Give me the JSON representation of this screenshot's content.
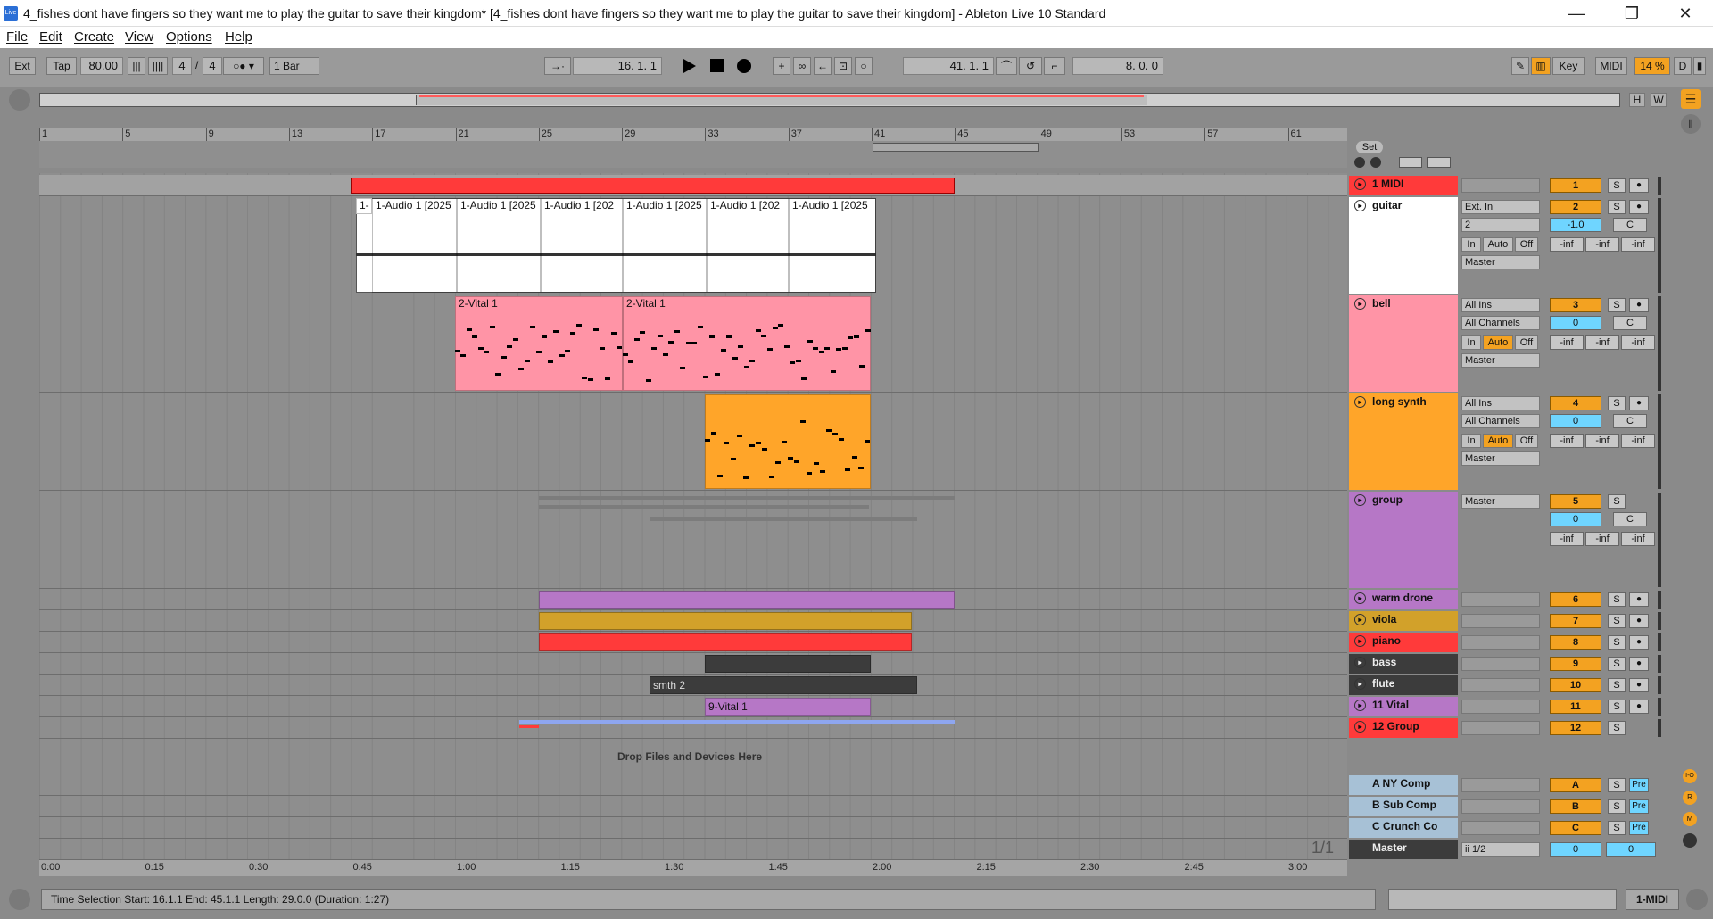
{
  "window": {
    "title": "4_fishes dont have fingers so they want me to play the guitar to save their kingdom*  [4_fishes dont have fingers so they want me to play the guitar to save their kingdom] - Ableton Live 10 Standard",
    "icon_label": "Live",
    "minimize": "—",
    "maximize": "❐",
    "close": "✕"
  },
  "menu": [
    "File",
    "Edit",
    "Create",
    "View",
    "Options",
    "Help"
  ],
  "control_bar": {
    "ext": "Ext",
    "tap": "Tap",
    "tempo": "80.00",
    "signature_num": "4",
    "signature_den": "4",
    "quantize": "1 Bar",
    "arrangement_position": "16.  1.  1",
    "loop_start": "41.  1.  1",
    "loop_length": "8.  0.  0",
    "key": "Key",
    "midi": "MIDI",
    "cpu": "14 %",
    "d": "D"
  },
  "overview": {
    "h": "H",
    "w": "W"
  },
  "ruler": [
    "1",
    "5",
    "9",
    "13",
    "17",
    "21",
    "25",
    "29",
    "33",
    "37",
    "41",
    "45",
    "49",
    "53",
    "57",
    "61"
  ],
  "set_label": "Set",
  "timeline": [
    "0:00",
    "0:15",
    "0:30",
    "0:45",
    "1:00",
    "1:15",
    "1:30",
    "1:45",
    "2:00",
    "2:15",
    "2:30",
    "2:45",
    "3:00"
  ],
  "tracks": [
    {
      "name": "1 MIDI",
      "num": "1",
      "color": "#ff3a3a"
    },
    {
      "name": "guitar",
      "num": "2",
      "color": "#ffffff",
      "input": "Ext. In",
      "channel": "2",
      "vol": "-1.0",
      "pan": "C",
      "out": "Master"
    },
    {
      "name": "bell",
      "num": "3",
      "color": "#ff94a6",
      "input": "All Ins",
      "channel": "All Channels",
      "vol": "0",
      "pan": "C",
      "out": "Master"
    },
    {
      "name": "long synth",
      "num": "4",
      "color": "#ffa529",
      "input": "All Ins",
      "channel": "All Channels",
      "vol": "0",
      "pan": "C",
      "out": "Master"
    },
    {
      "name": "group",
      "num": "5",
      "color": "#b677c6",
      "out": "Master",
      "vol": "0",
      "pan": "C"
    },
    {
      "name": "warm drone",
      "num": "6",
      "color": "#b677c6"
    },
    {
      "name": "viola",
      "num": "7",
      "color": "#d2a12a"
    },
    {
      "name": "piano",
      "num": "8",
      "color": "#ff3a3a"
    },
    {
      "name": "bass",
      "num": "9",
      "color": "#3c3c3c"
    },
    {
      "name": "flute",
      "num": "10",
      "color": "#3c3c3c"
    },
    {
      "name": "11 Vital",
      "num": "11",
      "color": "#b677c6"
    },
    {
      "name": "12 Group",
      "num": "12",
      "color": "#ff3a3a"
    }
  ],
  "returns": [
    {
      "name": "A NY Comp",
      "num": "A",
      "pre": "Pre"
    },
    {
      "name": "B Sub Comp",
      "num": "B",
      "pre": "Pre"
    },
    {
      "name": "C Crunch Co",
      "num": "C",
      "pre": "Pre"
    }
  ],
  "master": {
    "name": "Master",
    "out": "ii 1/2",
    "vol": "0",
    "pan": "0"
  },
  "io_labels": {
    "in": "In",
    "auto": "Auto",
    "off": "Off",
    "inf": "-inf",
    "s": "S"
  },
  "clips": {
    "audio": [
      "1-",
      "1-Audio 1 [2025",
      "1-Audio 1 [2025",
      "1-Audio 1 [202",
      "1-Audio 1 [2025",
      "1-Audio 1 [202",
      "1-Audio 1 [2025"
    ],
    "bell": [
      "2-Vital 1",
      "2-Vital 1"
    ],
    "smth": "smth 2",
    "vital9": "9-Vital 1"
  },
  "drop_hint": "Drop Files and Devices Here",
  "page_count": "1/1",
  "status": {
    "text": "Time Selection    Start: 16.1.1    End: 45.1.1    Length: 29.0.0  (Duration: 1:27)",
    "right_label": "1-MIDI"
  },
  "side_buttons": [
    "I-O",
    "R",
    "M"
  ]
}
